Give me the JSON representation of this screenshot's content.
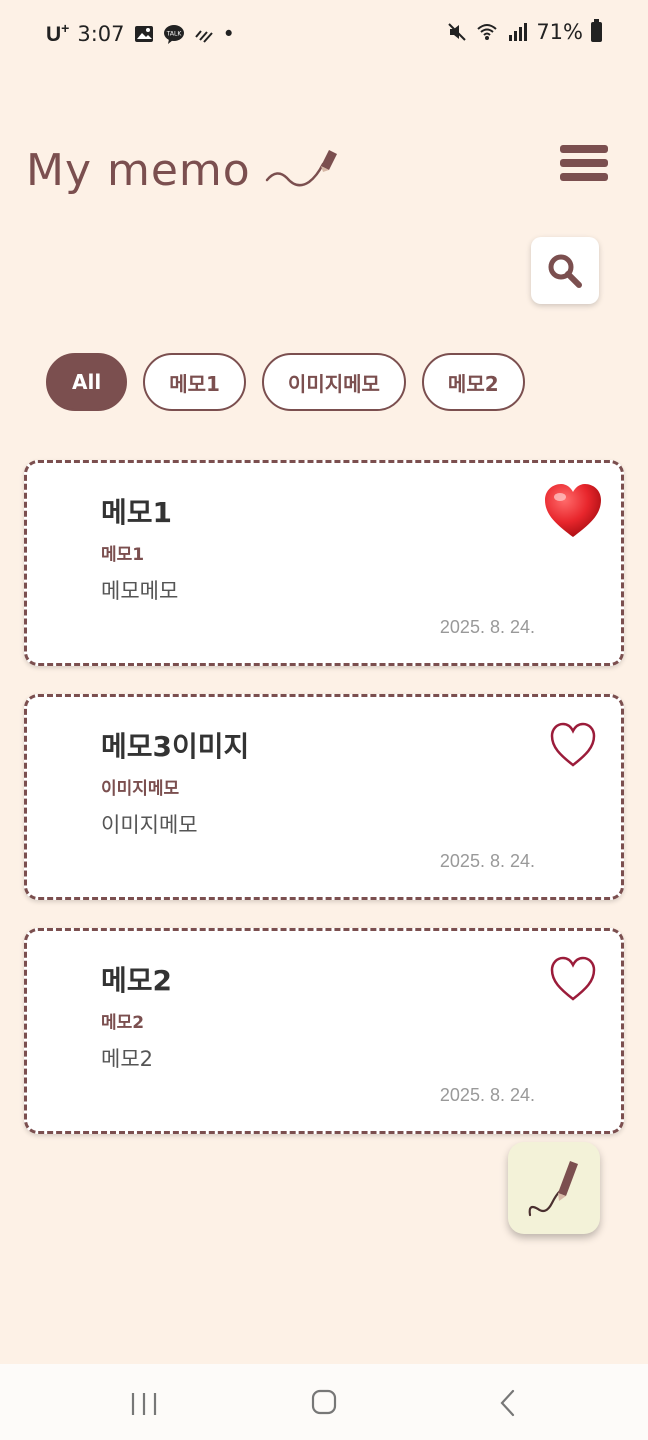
{
  "status_bar": {
    "carrier": "U",
    "carrier_sup": "+",
    "time": "3:07",
    "dot": "•",
    "battery": "71%"
  },
  "header": {
    "logo_text": "My memo",
    "icons": [
      "menu-icon",
      "search-icon"
    ]
  },
  "filters": [
    {
      "label": "All",
      "active": true
    },
    {
      "label": "메모1",
      "active": false
    },
    {
      "label": "이미지메모",
      "active": false
    },
    {
      "label": "메모2",
      "active": false
    }
  ],
  "memos": [
    {
      "title": "메모1",
      "category": "메모1",
      "body": "메모메모",
      "date": "2025. 8. 24.",
      "favorite": true
    },
    {
      "title": "메모3이미지",
      "category": "이미지메모",
      "body": "이미지메모",
      "date": "2025. 8. 24.",
      "favorite": false
    },
    {
      "title": "메모2",
      "category": "메모2",
      "body": "메모2",
      "date": "2025. 8. 24.",
      "favorite": false
    }
  ],
  "colors": {
    "background": "#fdf1e6",
    "accent": "#7b4f4f",
    "heart_filled": "#e8262c",
    "heart_outline": "#9b1c3a",
    "fab_bg": "#f3f2d8"
  }
}
